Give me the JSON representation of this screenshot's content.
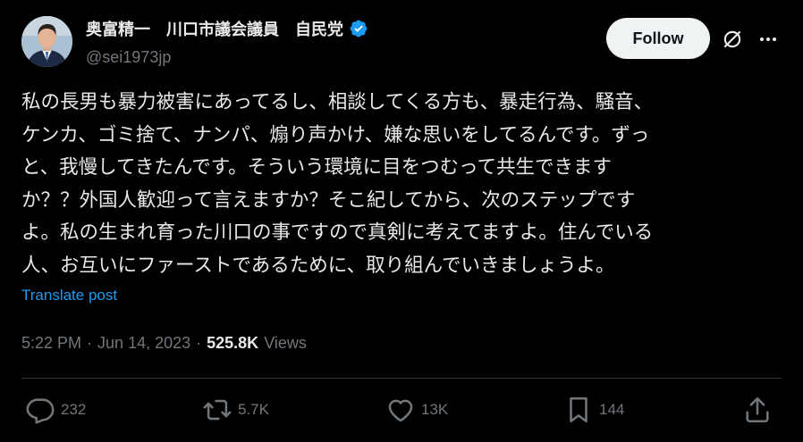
{
  "author": {
    "display_name": "奥富精一　川口市議会議員　自民党",
    "handle": "@sei1973jp",
    "verified": true
  },
  "header": {
    "follow_label": "Follow",
    "grok_icon": "grok-icon",
    "more_icon": "more-icon"
  },
  "post": {
    "text": "私の長男も暴力被害にあってるし、相談してくる方も、暴走行為、騒音、\nケンカ、ゴミ捨て、ナンパ、煽り声かけ、嫌な思いをしてるんです。ずっ\nと、我慢してきたんです。そういう環境に目をつむって共生できます\nか？？外国人歓迎って言えますか？そこ紀してから、次のステップです\nよ。私の生まれ育った川口の事ですので真剣に考えてますよ。住んでいる\n人、お互いにファーストであるために、取り組んでいきましょうよ。",
    "translate_label": "Translate post"
  },
  "meta": {
    "time": "5:22 PM",
    "sep1": "·",
    "date": "Jun 14, 2023",
    "sep2": "·",
    "views_count": "525.8K",
    "views_label": "Views"
  },
  "actions": {
    "replies": "232",
    "reposts": "5.7K",
    "likes": "13K",
    "bookmarks": "144"
  },
  "colors": {
    "background": "#000000",
    "text": "#e7e9ea",
    "muted": "#71767b",
    "link": "#1d9bf0",
    "verified_badge": "#1d9bf0",
    "follow_bg": "#eff3f4"
  }
}
